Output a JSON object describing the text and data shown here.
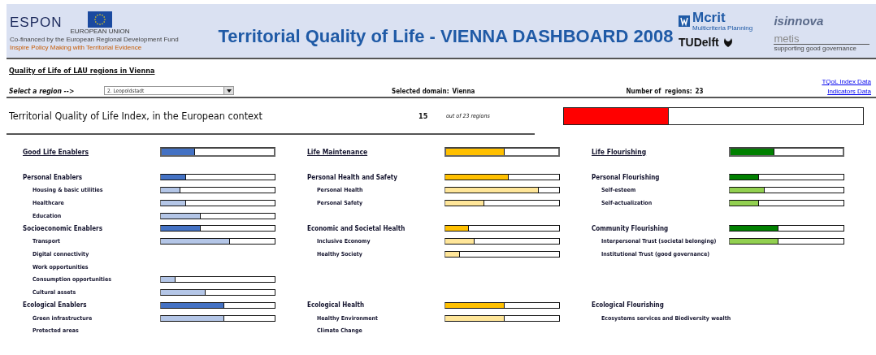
{
  "header": {
    "title": "Territorial Quality of Life - VIENNA DASHBOARD 2008",
    "left_logo": {
      "name": "ESPON",
      "eu_label": "EUROPEAN UNION",
      "line_1": "Co-financed by the European Regional Development Fund",
      "line_2": "Inspire Policy Making with Territorial Evidence"
    },
    "right_logos": {
      "mcrit": "Mcrit",
      "mcrit_sub": "Multicriteria Planning",
      "isinnova": "isinnova",
      "tudelft_t": "T",
      "tudelft_rest": "UDelft",
      "metis": "metis",
      "metis_sub": "supporting good governance"
    }
  },
  "subtitle": "Quality of Life of LAU regions in Vienna",
  "controls": {
    "select_label": "Select a region -->",
    "region": "2. Leopoldstadt",
    "domain_label": "Selected domain:",
    "domain_value": "Vienna",
    "count_label": "Number of  regions:",
    "count_value": "23"
  },
  "links": [
    "TQoL Index Data",
    "Indicators Data"
  ],
  "index": {
    "label": "Territorial Quality of Life Index, in the European context",
    "rank": "15",
    "rank_note": "out of 23 regions",
    "level": 0.35,
    "color": "#ff0000"
  },
  "domains": [
    {
      "title": "Good Life Enablers",
      "color": "#4472c4",
      "level": 0.3,
      "groups": [
        {
          "name": "Personal Enablers",
          "level": 0.22,
          "items": [
            {
              "name": "Housing & basic utilities",
              "level": 0.17,
              "color": "#b4c6e7"
            },
            {
              "name": "Healthcare",
              "level": 0.22,
              "color": "#b4c6e7"
            },
            {
              "name": "Education",
              "level": 0.35,
              "color": "#b4c6e7"
            }
          ]
        },
        {
          "name": "Socioeconomic Enablers",
          "level": 0.35,
          "items": [
            {
              "name": "Transport",
              "level": 0.61,
              "color": "#b4c6e7"
            },
            {
              "name": "Digital connectivity"
            },
            {
              "name": "Work opportunities"
            },
            {
              "name": "Consumption opportunities",
              "level": 0.13,
              "color": "#b4c6e7"
            },
            {
              "name": "Cultural assets",
              "level": 0.39,
              "color": "#b4c6e7"
            }
          ]
        },
        {
          "name": "Ecological Enablers",
          "level": 0.56,
          "items": [
            {
              "name": "Green infrastructure",
              "level": 0.56,
              "color": "#b4c6e7"
            },
            {
              "name": "Protected areas"
            }
          ]
        }
      ]
    },
    {
      "title": "Life Maintenance",
      "color": "#ffc000",
      "level": 0.52,
      "groups": [
        {
          "name": "Personal Health and Safety",
          "level": 0.56,
          "items": [
            {
              "name": "Personal Health",
              "level": 0.82,
              "color": "#ffe699"
            },
            {
              "name": "Personal Safety",
              "level": 0.34,
              "color": "#ffe699"
            }
          ]
        },
        {
          "name": "Economic and Societal Health",
          "level": 0.21,
          "items": [
            {
              "name": "Inclusive Economy",
              "level": 0.26,
              "color": "#ffe699"
            },
            {
              "name": "Healthy Society",
              "level": 0.13,
              "color": "#ffe699"
            }
          ]
        },
        {
          "name": "Ecological Health",
          "level": 0.52,
          "items": [
            {
              "name": "Healthy Environment",
              "level": 0.52,
              "color": "#ffe699"
            },
            {
              "name": "Climate Change"
            }
          ]
        }
      ]
    },
    {
      "title": "Life Flourishing",
      "color": "#008000",
      "level": 0.39,
      "groups": [
        {
          "name": "Personal Flourishing",
          "level": 0.26,
          "items": [
            {
              "name": "Self-esteem",
              "level": 0.31,
              "color": "#92d050"
            },
            {
              "name": "Self-actualization",
              "level": 0.26,
              "color": "#92d050"
            }
          ]
        },
        {
          "name": "Community Flourishing",
          "level": 0.43,
          "items": [
            {
              "name": "Interpersonal Trust (societal belonging)",
              "level": 0.43,
              "color": "#92d050"
            },
            {
              "name": "Institutional Trust (good governance)"
            }
          ]
        },
        {
          "name": "Ecological Flourishing",
          "items": [
            {
              "name": "Ecosystems services and Biodiversity wealth"
            }
          ]
        }
      ]
    }
  ]
}
